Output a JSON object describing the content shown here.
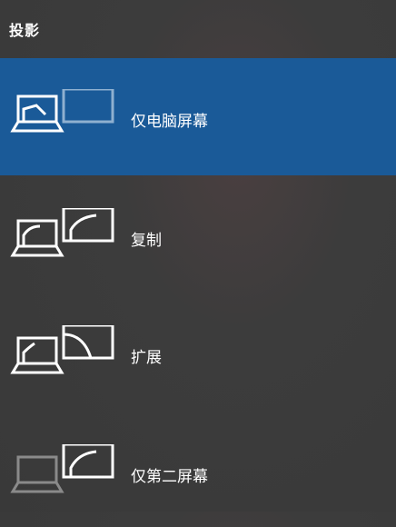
{
  "panel": {
    "title": "投影"
  },
  "options": [
    {
      "label": "仅电脑屏幕",
      "icon": "pc-screen-only-icon",
      "selected": true
    },
    {
      "label": "复制",
      "icon": "duplicate-icon",
      "selected": false
    },
    {
      "label": "扩展",
      "icon": "extend-icon",
      "selected": false
    },
    {
      "label": "仅第二屏幕",
      "icon": "second-screen-only-icon",
      "selected": false
    }
  ],
  "colors": {
    "selected_background": "#1a5a98",
    "panel_background": "#3c3c3c",
    "icon_active": "#ffffff",
    "icon_dimmed": "#8a8a8a",
    "icon_faded_monitor": "#8fb0d0"
  }
}
